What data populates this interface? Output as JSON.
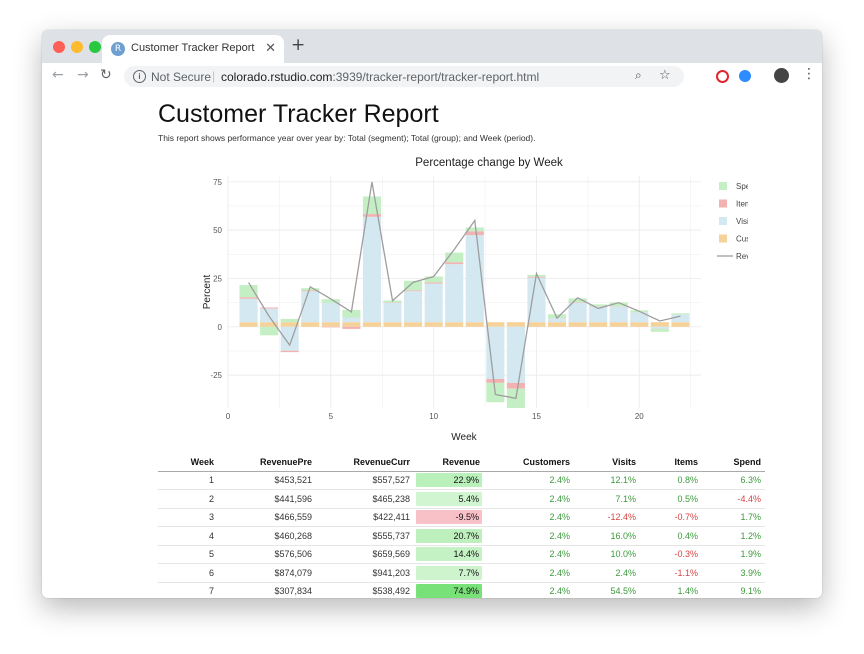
{
  "browser": {
    "tab_title": "Customer Tracker Report",
    "tab_icon_letter": "R",
    "security_label": "Not Secure",
    "url_host": "colorado.rstudio.com",
    "url_rest": ":3939/tracker-report/tracker-report.html"
  },
  "report": {
    "title": "Customer Tracker Report",
    "subtitle": "This report shows performance year over year by: Total (segment); Total (group); and Week (period)."
  },
  "colors": {
    "spend": "#c4efc4",
    "items": "#f3b2b2",
    "visits": "#d3e8f0",
    "customers": "#f6d29b",
    "revenue_line": "#9e9e9e",
    "pos_text": "#3c9a3c",
    "neg_text": "#d64545"
  },
  "chart_data": {
    "type": "bar",
    "title": "Percentage change by Week",
    "xlabel": "Week",
    "ylabel": "Percent",
    "xlim": [
      0,
      23
    ],
    "ylim": [
      -42,
      78
    ],
    "x_ticks": [
      0,
      5,
      10,
      15,
      20
    ],
    "y_ticks": [
      -25,
      0,
      25,
      50,
      75
    ],
    "grid": true,
    "legend_position": "right",
    "x": [
      1,
      2,
      3,
      4,
      5,
      6,
      7,
      8,
      9,
      10,
      11,
      12,
      13,
      14,
      15,
      16,
      17,
      18,
      19,
      20,
      21,
      22
    ],
    "series": [
      {
        "name": "Customers",
        "values": [
          2.4,
          2.4,
          2.4,
          2.4,
          2.4,
          2.4,
          2.4,
          2.4,
          2.4,
          2.4,
          2.4,
          2.4,
          2.4,
          2.4,
          2.4,
          2.4,
          2.4,
          2.4,
          2.4,
          2.4,
          2.4,
          2.4
        ]
      },
      {
        "name": "Visits",
        "values": [
          12.1,
          7.1,
          -12.4,
          16.0,
          10.0,
          2.4,
          54.5,
          10.0,
          16.0,
          20.0,
          30.0,
          45.0,
          -27.0,
          -29.0,
          23.0,
          2.0,
          10.0,
          8.0,
          8.0,
          5.0,
          -1.0,
          4.0
        ]
      },
      {
        "name": "Items",
        "values": [
          0.8,
          0.5,
          -0.7,
          0.4,
          -0.3,
          -1.1,
          1.4,
          0.2,
          0.4,
          0.6,
          1.0,
          2.0,
          -2.0,
          -3.0,
          0.5,
          0.1,
          0.3,
          0.2,
          0.2,
          0.1,
          -0.1,
          0.1
        ]
      },
      {
        "name": "Spend",
        "values": [
          6.3,
          -4.4,
          1.7,
          1.2,
          1.9,
          3.9,
          9.1,
          1.0,
          5.0,
          3.0,
          5.0,
          2.0,
          -10.0,
          -10.0,
          1.0,
          2.0,
          2.0,
          1.0,
          2.0,
          1.0,
          -1.5,
          0.5
        ]
      },
      {
        "name": "Revenue",
        "type": "line",
        "values": [
          22.9,
          5.4,
          -9.5,
          20.7,
          14.4,
          7.7,
          74.9,
          13.5,
          23.0,
          26.0,
          40.0,
          55.0,
          -35.0,
          -37.0,
          27.5,
          4.5,
          15.0,
          9.5,
          12.5,
          8.0,
          3.0,
          5.5
        ]
      }
    ],
    "legend": [
      "Spend",
      "Items",
      "Visits",
      "Customers",
      "Revenue"
    ]
  },
  "table": {
    "columns": [
      "Week",
      "RevenuePre",
      "RevenueCurr",
      "Revenue",
      "Customers",
      "Visits",
      "Items",
      "Spend"
    ],
    "rows": [
      {
        "week": "1",
        "pre": "$453,521",
        "curr": "$557,527",
        "rev": "22.9%",
        "rev_value": 22.9,
        "cust": "2.4%",
        "visits": "12.1%",
        "items": "0.8%",
        "spend": "6.3%"
      },
      {
        "week": "2",
        "pre": "$441,596",
        "curr": "$465,238",
        "rev": "5.4%",
        "rev_value": 5.4,
        "cust": "2.4%",
        "visits": "7.1%",
        "items": "0.5%",
        "spend": "-4.4%"
      },
      {
        "week": "3",
        "pre": "$466,559",
        "curr": "$422,411",
        "rev": "-9.5%",
        "rev_value": -9.5,
        "cust": "2.4%",
        "visits": "-12.4%",
        "items": "-0.7%",
        "spend": "1.7%"
      },
      {
        "week": "4",
        "pre": "$460,268",
        "curr": "$555,737",
        "rev": "20.7%",
        "rev_value": 20.7,
        "cust": "2.4%",
        "visits": "16.0%",
        "items": "0.4%",
        "spend": "1.2%"
      },
      {
        "week": "5",
        "pre": "$576,506",
        "curr": "$659,569",
        "rev": "14.4%",
        "rev_value": 14.4,
        "cust": "2.4%",
        "visits": "10.0%",
        "items": "-0.3%",
        "spend": "1.9%"
      },
      {
        "week": "6",
        "pre": "$874,079",
        "curr": "$941,203",
        "rev": "7.7%",
        "rev_value": 7.7,
        "cust": "2.4%",
        "visits": "2.4%",
        "items": "-1.1%",
        "spend": "3.9%"
      },
      {
        "week": "7",
        "pre": "$307,834",
        "curr": "$538,492",
        "rev": "74.9%",
        "rev_value": 74.9,
        "cust": "2.4%",
        "visits": "54.5%",
        "items": "1.4%",
        "spend": "9.1%"
      }
    ]
  }
}
